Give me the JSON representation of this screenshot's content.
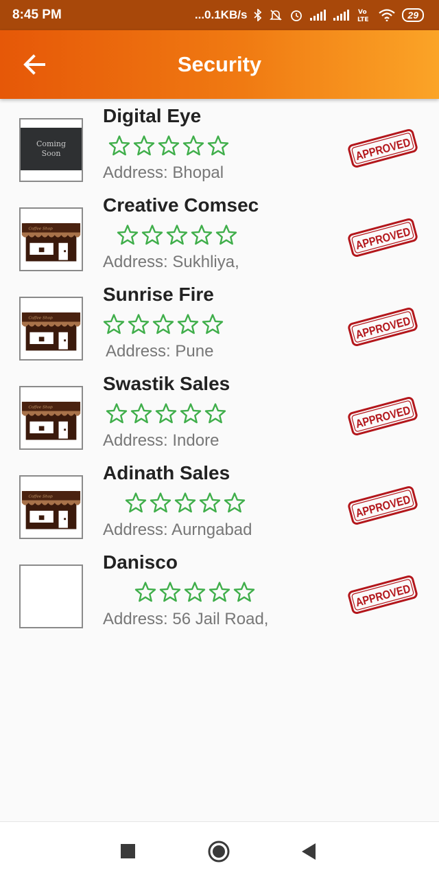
{
  "status_bar": {
    "time": "8:45 PM",
    "network_speed": "...0.1KB/s",
    "battery": "29",
    "icons": [
      "bluetooth-icon",
      "mute-icon",
      "alarm-icon",
      "signal-icon",
      "signal-icon",
      "volte-icon",
      "wifi-icon",
      "battery-icon"
    ]
  },
  "app_bar": {
    "title": "Security",
    "back_icon": "arrow-left-icon",
    "colors": {
      "start": "#e65808",
      "end": "#fba427"
    }
  },
  "items": [
    {
      "name": "Digital Eye",
      "address": "Address: Bhopal",
      "thumbnail": "coming-soon",
      "thumb_text": [
        "Coming",
        "Soon"
      ],
      "rating": 0,
      "max_rating": 5,
      "stamp": "APPROVED"
    },
    {
      "name": "Creative Comsec",
      "address": "Address: Sukhliya,",
      "thumbnail": "shop",
      "rating": 0,
      "max_rating": 5,
      "stamp": "APPROVED"
    },
    {
      "name": "Sunrise Fire",
      "address": "Address: Pune",
      "thumbnail": "shop",
      "rating": 0,
      "max_rating": 5,
      "stamp": "APPROVED"
    },
    {
      "name": "Swastik Sales",
      "address": "Address: Indore",
      "thumbnail": "shop",
      "rating": 0,
      "max_rating": 5,
      "stamp": "APPROVED"
    },
    {
      "name": "Adinath Sales",
      "address": "Address: Aurngabad",
      "thumbnail": "shop",
      "rating": 0,
      "max_rating": 5,
      "stamp": "APPROVED"
    },
    {
      "name": "Danisco",
      "address": "Address: 56 Jail Road,",
      "thumbnail": "blank",
      "rating": 0,
      "max_rating": 5,
      "stamp": "APPROVED"
    }
  ],
  "colors": {
    "star": "#3fae4a",
    "stamp": "#b3161b",
    "name": "#222222",
    "address": "#777777"
  },
  "nav_bar": {
    "icons": [
      "recents-square-icon",
      "home-circle-icon",
      "back-triangle-icon"
    ]
  }
}
